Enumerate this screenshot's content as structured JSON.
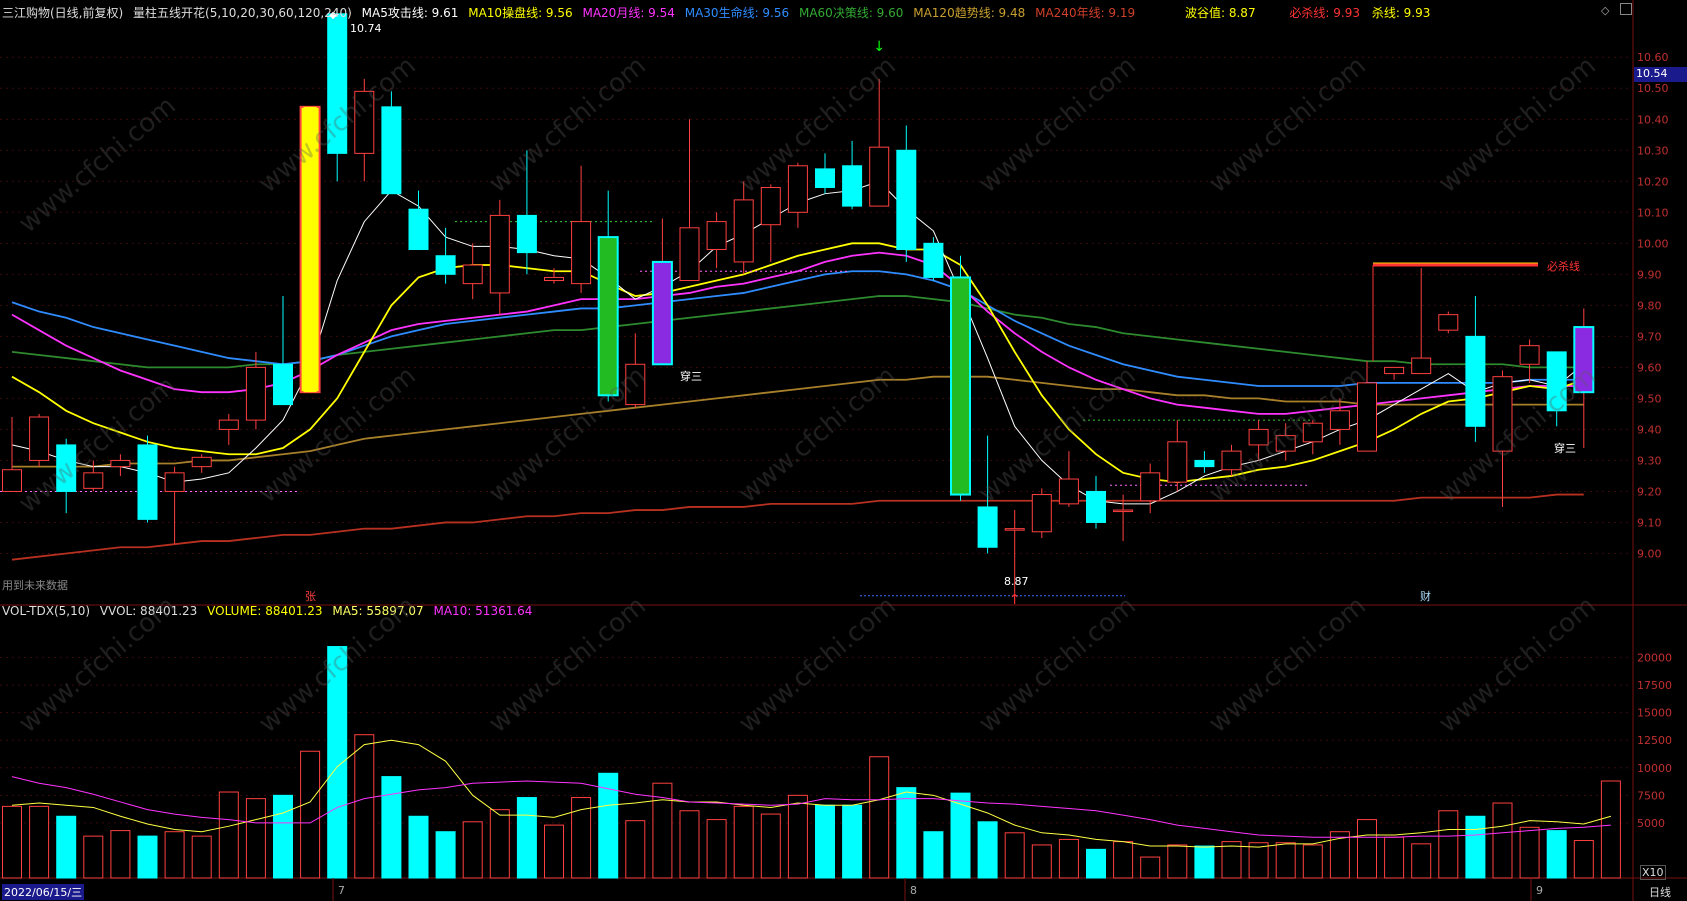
{
  "header": {
    "stock_title": "三江购物(日线,前复权)",
    "indicator_title": "量柱五线开花(5,10,20,30,60,120,240)",
    "ma_items": [
      {
        "label": "MA5攻击线: 9.61",
        "color": "#ffffff"
      },
      {
        "label": "MA10操盘线: 9.56",
        "color": "#ffff00"
      },
      {
        "label": "MA20月线: 9.54",
        "color": "#ff33ff"
      },
      {
        "label": "MA30生命线: 9.56",
        "color": "#2f8cff"
      },
      {
        "label": "MA60决策线: 9.60",
        "color": "#33aa33"
      },
      {
        "label": "MA120趋势线: 9.48",
        "color": "#c8a030"
      },
      {
        "label": "MA240年线: 9.19",
        "color": "#d0402a"
      }
    ],
    "right_items": [
      {
        "label": "波谷值: 8.87",
        "color": "#ffff00"
      },
      {
        "label": "必杀线: 9.93",
        "color": "#ff3333"
      },
      {
        "label": "杀线: 9.93",
        "color": "#ffff00"
      }
    ]
  },
  "volume_header": {
    "title": "VOL-TDX(5,10)",
    "items": [
      {
        "label": "VVOL: 88401.23",
        "color": "#dddddd"
      },
      {
        "label": "VOLUME: 88401.23",
        "color": "#ffff00"
      },
      {
        "label": "MA5: 55897.07",
        "color": "#ffff66"
      },
      {
        "label": "MA10: 51361.64",
        "color": "#ff33ff"
      }
    ]
  },
  "labels": {
    "future_data": "用到未来数据",
    "zhang": "张",
    "cai": "财",
    "bisha": "必杀线",
    "high_value": "10.74",
    "low_value": "8.87",
    "chuansan": "穿三",
    "x10": "X10",
    "date": "2022/06/15/三",
    "period": "日线",
    "month7": "7",
    "month8": "8",
    "month9": "9",
    "watermark": "www.cfchi.com",
    "current_price": "10.54"
  },
  "chart_data": [
    {
      "type": "candlestick",
      "ylim": [
        8.85,
        10.72
      ],
      "ticks": [
        "9.00",
        "9.10",
        "9.20",
        "9.30",
        "9.40",
        "9.50",
        "9.60",
        "9.70",
        "9.80",
        "9.90",
        "10.00",
        "10.10",
        "10.20",
        "10.30",
        "10.40",
        "10.50",
        "10.60"
      ],
      "candles": [
        {
          "o": 9.2,
          "h": 9.44,
          "l": 9.2,
          "c": 9.27
        },
        {
          "o": 9.3,
          "h": 9.45,
          "l": 9.28,
          "c": 9.44
        },
        {
          "o": 9.35,
          "h": 9.37,
          "l": 9.13,
          "c": 9.2
        },
        {
          "o": 9.21,
          "h": 9.3,
          "l": 9.2,
          "c": 9.26
        },
        {
          "o": 9.28,
          "h": 9.32,
          "l": 9.25,
          "c": 9.3
        },
        {
          "o": 9.35,
          "h": 9.38,
          "l": 9.1,
          "c": 9.11
        },
        {
          "o": 9.2,
          "h": 9.28,
          "l": 9.03,
          "c": 9.26
        },
        {
          "o": 9.28,
          "h": 9.32,
          "l": 9.26,
          "c": 9.31
        },
        {
          "o": 9.4,
          "h": 9.45,
          "l": 9.35,
          "c": 9.43
        },
        {
          "o": 9.43,
          "h": 9.65,
          "l": 9.4,
          "c": 9.6
        },
        {
          "o": 9.61,
          "h": 9.83,
          "l": 9.48,
          "c": 9.48
        },
        {
          "o": 9.52,
          "h": 10.44,
          "l": 9.52,
          "c": 10.44
        },
        {
          "o": 10.74,
          "h": 10.74,
          "l": 10.2,
          "c": 10.29
        },
        {
          "o": 10.29,
          "h": 10.53,
          "l": 10.2,
          "c": 10.49
        },
        {
          "o": 10.44,
          "h": 10.49,
          "l": 10.16,
          "c": 10.16
        },
        {
          "o": 10.11,
          "h": 10.17,
          "l": 9.99,
          "c": 9.98
        },
        {
          "o": 9.96,
          "h": 10.05,
          "l": 9.87,
          "c": 9.9
        },
        {
          "o": 9.87,
          "h": 10.0,
          "l": 9.82,
          "c": 9.93
        },
        {
          "o": 9.84,
          "h": 10.14,
          "l": 9.77,
          "c": 10.09
        },
        {
          "o": 10.09,
          "h": 10.3,
          "l": 9.9,
          "c": 9.97
        },
        {
          "o": 9.88,
          "h": 9.92,
          "l": 9.87,
          "c": 9.89
        },
        {
          "o": 9.87,
          "h": 10.25,
          "l": 9.84,
          "c": 10.07
        },
        {
          "o": 10.02,
          "h": 10.17,
          "l": 9.49,
          "c": 9.51
        },
        {
          "o": 9.48,
          "h": 9.71,
          "l": 9.47,
          "c": 9.61
        },
        {
          "o": 9.61,
          "h": 10.08,
          "l": 9.61,
          "c": 9.94
        },
        {
          "o": 9.88,
          "h": 10.4,
          "l": 9.88,
          "c": 10.05
        },
        {
          "o": 9.98,
          "h": 10.1,
          "l": 9.92,
          "c": 10.07
        },
        {
          "o": 9.94,
          "h": 10.2,
          "l": 9.9,
          "c": 10.14
        },
        {
          "o": 10.06,
          "h": 10.19,
          "l": 9.94,
          "c": 10.18
        },
        {
          "o": 10.1,
          "h": 10.26,
          "l": 10.05,
          "c": 10.25
        },
        {
          "o": 10.24,
          "h": 10.29,
          "l": 10.16,
          "c": 10.18
        },
        {
          "o": 10.25,
          "h": 10.33,
          "l": 10.11,
          "c": 10.12
        },
        {
          "o": 10.12,
          "h": 10.53,
          "l": 10.12,
          "c": 10.31
        },
        {
          "o": 10.3,
          "h": 10.38,
          "l": 9.94,
          "c": 9.98
        },
        {
          "o": 10.0,
          "h": 10.02,
          "l": 9.88,
          "c": 9.89
        },
        {
          "o": 9.89,
          "h": 9.96,
          "l": 9.17,
          "c": 9.19
        },
        {
          "o": 9.15,
          "h": 9.38,
          "l": 9.0,
          "c": 9.02
        },
        {
          "o": 9.08,
          "h": 9.14,
          "l": 8.87,
          "c": 9.08
        },
        {
          "o": 9.07,
          "h": 9.21,
          "l": 9.05,
          "c": 9.19
        },
        {
          "o": 9.16,
          "h": 9.33,
          "l": 9.15,
          "c": 9.24
        },
        {
          "o": 9.2,
          "h": 9.25,
          "l": 9.08,
          "c": 9.1
        },
        {
          "o": 9.14,
          "h": 9.19,
          "l": 9.04,
          "c": 9.14
        },
        {
          "o": 9.17,
          "h": 9.29,
          "l": 9.13,
          "c": 9.26
        },
        {
          "o": 9.23,
          "h": 9.43,
          "l": 9.2,
          "c": 9.36
        },
        {
          "o": 9.3,
          "h": 9.33,
          "l": 9.26,
          "c": 9.28
        },
        {
          "o": 9.27,
          "h": 9.35,
          "l": 9.25,
          "c": 9.33
        },
        {
          "o": 9.35,
          "h": 9.43,
          "l": 9.3,
          "c": 9.4
        },
        {
          "o": 9.33,
          "h": 9.42,
          "l": 9.3,
          "c": 9.38
        },
        {
          "o": 9.36,
          "h": 9.43,
          "l": 9.32,
          "c": 9.42
        },
        {
          "o": 9.4,
          "h": 9.5,
          "l": 9.35,
          "c": 9.46
        },
        {
          "o": 9.33,
          "h": 9.62,
          "l": 9.33,
          "c": 9.55
        },
        {
          "o": 9.58,
          "h": 9.6,
          "l": 9.56,
          "c": 9.6
        },
        {
          "o": 9.58,
          "h": 9.92,
          "l": 9.58,
          "c": 9.63
        },
        {
          "o": 9.72,
          "h": 9.78,
          "l": 9.71,
          "c": 9.77
        },
        {
          "o": 9.7,
          "h": 9.83,
          "l": 9.36,
          "c": 9.41
        },
        {
          "o": 9.33,
          "h": 9.59,
          "l": 9.15,
          "c": 9.57
        },
        {
          "o": 9.61,
          "h": 9.69,
          "l": 9.55,
          "c": 9.67
        },
        {
          "o": 9.65,
          "h": 9.65,
          "l": 9.41,
          "c": 9.46
        },
        {
          "o": 9.52,
          "h": 9.79,
          "l": 9.34,
          "c": 9.73
        }
      ],
      "ma5": [
        9.35,
        9.33,
        9.3,
        9.28,
        9.28,
        9.26,
        9.23,
        9.24,
        9.26,
        9.34,
        9.43,
        9.6,
        9.88,
        10.07,
        10.17,
        10.12,
        10.02,
        9.99,
        9.99,
        9.98,
        9.96,
        9.95,
        9.89,
        9.82,
        9.86,
        9.91,
        9.99,
        10.03,
        10.08,
        10.13,
        10.16,
        10.17,
        10.2,
        10.11,
        10.04,
        9.84,
        9.63,
        9.41,
        9.3,
        9.22,
        9.17,
        9.16,
        9.16,
        9.2,
        9.25,
        9.28,
        9.3,
        9.33,
        9.36,
        9.4,
        9.43,
        9.48,
        9.53,
        9.58,
        9.52,
        9.55,
        9.56,
        9.54,
        9.61
      ],
      "ma10": [
        9.57,
        9.52,
        9.46,
        9.42,
        9.39,
        9.36,
        9.34,
        9.33,
        9.32,
        9.32,
        9.34,
        9.4,
        9.5,
        9.65,
        9.8,
        9.89,
        9.92,
        9.93,
        9.93,
        9.92,
        9.91,
        9.91,
        9.87,
        9.83,
        9.84,
        9.86,
        9.88,
        9.9,
        9.93,
        9.96,
        9.98,
        10.0,
        10.0,
        9.98,
        9.98,
        9.93,
        9.8,
        9.65,
        9.51,
        9.4,
        9.32,
        9.26,
        9.24,
        9.23,
        9.24,
        9.25,
        9.27,
        9.28,
        9.3,
        9.33,
        9.36,
        9.4,
        9.45,
        9.49,
        9.5,
        9.52,
        9.54,
        9.53,
        9.56
      ],
      "ma20": [
        9.77,
        9.72,
        9.67,
        9.63,
        9.59,
        9.56,
        9.53,
        9.52,
        9.52,
        9.53,
        9.55,
        9.59,
        9.64,
        9.68,
        9.72,
        9.74,
        9.75,
        9.76,
        9.77,
        9.78,
        9.8,
        9.82,
        9.82,
        9.82,
        9.83,
        9.84,
        9.86,
        9.87,
        9.89,
        9.91,
        9.94,
        9.96,
        9.97,
        9.96,
        9.93,
        9.86,
        9.78,
        9.71,
        9.65,
        9.6,
        9.56,
        9.53,
        9.5,
        9.48,
        9.47,
        9.46,
        9.45,
        9.45,
        9.46,
        9.47,
        9.48,
        9.49,
        9.5,
        9.51,
        9.52,
        9.53,
        9.54,
        9.54,
        9.54
      ],
      "ma30": [
        9.81,
        9.78,
        9.76,
        9.73,
        9.71,
        9.69,
        9.67,
        9.65,
        9.63,
        9.62,
        9.61,
        9.62,
        9.64,
        9.67,
        9.7,
        9.72,
        9.74,
        9.75,
        9.76,
        9.77,
        9.78,
        9.79,
        9.79,
        9.8,
        9.81,
        9.82,
        9.83,
        9.84,
        9.86,
        9.88,
        9.9,
        9.91,
        9.91,
        9.9,
        9.88,
        9.85,
        9.8,
        9.75,
        9.71,
        9.67,
        9.64,
        9.61,
        9.59,
        9.57,
        9.56,
        9.55,
        9.54,
        9.54,
        9.54,
        9.54,
        9.55,
        9.55,
        9.55,
        9.55,
        9.55,
        9.55,
        9.56,
        9.56,
        9.56
      ],
      "ma60": [
        9.65,
        9.64,
        9.63,
        9.62,
        9.61,
        9.6,
        9.6,
        9.6,
        9.6,
        9.61,
        9.61,
        9.62,
        9.64,
        9.65,
        9.66,
        9.67,
        9.68,
        9.69,
        9.7,
        9.71,
        9.72,
        9.72,
        9.73,
        9.74,
        9.75,
        9.76,
        9.77,
        9.78,
        9.79,
        9.8,
        9.81,
        9.82,
        9.83,
        9.83,
        9.82,
        9.81,
        9.79,
        9.77,
        9.76,
        9.74,
        9.73,
        9.71,
        9.7,
        9.69,
        9.68,
        9.67,
        9.66,
        9.65,
        9.64,
        9.63,
        9.62,
        9.62,
        9.61,
        9.61,
        9.61,
        9.61,
        9.6,
        9.6,
        9.6
      ],
      "ma120": [
        9.28,
        9.28,
        9.28,
        9.28,
        9.29,
        9.29,
        9.29,
        9.3,
        9.3,
        9.31,
        9.32,
        9.33,
        9.35,
        9.37,
        9.38,
        9.39,
        9.4,
        9.41,
        9.42,
        9.43,
        9.44,
        9.45,
        9.46,
        9.47,
        9.48,
        9.49,
        9.5,
        9.51,
        9.52,
        9.53,
        9.54,
        9.55,
        9.56,
        9.56,
        9.57,
        9.57,
        9.57,
        9.56,
        9.55,
        9.54,
        9.53,
        9.53,
        9.52,
        9.51,
        9.51,
        9.5,
        9.5,
        9.49,
        9.49,
        9.49,
        9.48,
        9.48,
        9.48,
        9.48,
        9.48,
        9.48,
        9.48,
        9.48,
        9.48
      ],
      "ma240": [
        8.98,
        8.99,
        9.0,
        9.01,
        9.02,
        9.02,
        9.03,
        9.04,
        9.04,
        9.05,
        9.06,
        9.06,
        9.07,
        9.08,
        9.08,
        9.09,
        9.1,
        9.1,
        9.11,
        9.12,
        9.12,
        9.13,
        9.13,
        9.14,
        9.14,
        9.15,
        9.15,
        9.15,
        9.16,
        9.16,
        9.16,
        9.16,
        9.17,
        9.17,
        9.17,
        9.17,
        9.17,
        9.17,
        9.17,
        9.17,
        9.17,
        9.17,
        9.17,
        9.17,
        9.17,
        9.17,
        9.17,
        9.17,
        9.17,
        9.17,
        9.17,
        9.17,
        9.18,
        9.18,
        9.18,
        9.18,
        9.18,
        9.19,
        9.19
      ],
      "kill_line": 9.93,
      "valley": 8.87
    },
    {
      "type": "bar",
      "ylim": [
        0,
        22500
      ],
      "ticks": [
        "5000",
        "7500",
        "10000",
        "12500",
        "15000",
        "17500",
        "20000"
      ],
      "unit": "X10",
      "volume": [
        6500,
        6500,
        5600,
        3800,
        4300,
        3800,
        4200,
        3800,
        7800,
        7200,
        7500,
        11500,
        21000,
        13000,
        9200,
        5600,
        4200,
        5100,
        6200,
        7300,
        4800,
        7300,
        9500,
        5200,
        8600,
        6100,
        5300,
        6500,
        5800,
        7500,
        6600,
        6600,
        11000,
        8200,
        4200,
        7700,
        5100,
        4100,
        3000,
        3500,
        2600,
        3300,
        1900,
        3000,
        2900,
        3300,
        3200,
        3200,
        3000,
        4200,
        5300,
        3700,
        3100,
        6100,
        5600,
        6800,
        4600,
        4300,
        3400,
        8800
      ],
      "ma5": [
        6600,
        6800,
        6600,
        6400,
        5600,
        4900,
        4400,
        4200,
        4700,
        5300,
        5900,
        6900,
        10100,
        12100,
        12500,
        12100,
        10600,
        7500,
        5700,
        5700,
        5500,
        6200,
        6600,
        6800,
        7100,
        6900,
        6900,
        6600,
        6400,
        6800,
        6600,
        6600,
        7100,
        7800,
        7500,
        6700,
        5900,
        4800,
        4100,
        3900,
        3500,
        3300,
        2900,
        2900,
        2800,
        2900,
        2800,
        3100,
        3100,
        3600,
        3900,
        3900,
        4100,
        4400,
        4400,
        4700,
        5200,
        5100,
        4900,
        5600
      ],
      "ma10": [
        9200,
        8600,
        8200,
        7600,
        6900,
        6200,
        5800,
        5500,
        5300,
        5000,
        5000,
        5000,
        6400,
        7200,
        7600,
        8000,
        8200,
        8600,
        8700,
        8800,
        8700,
        8600,
        8100,
        7600,
        7300,
        6900,
        6800,
        6700,
        6600,
        6700,
        7200,
        7100,
        7100,
        7200,
        7200,
        7000,
        6800,
        6700,
        6500,
        6300,
        6100,
        5700,
        5300,
        4800,
        4500,
        4200,
        3900,
        3800,
        3700,
        3700,
        3700,
        3700,
        3800,
        3800,
        3900,
        4100,
        4300,
        4500,
        4600,
        4800
      ]
    }
  ]
}
